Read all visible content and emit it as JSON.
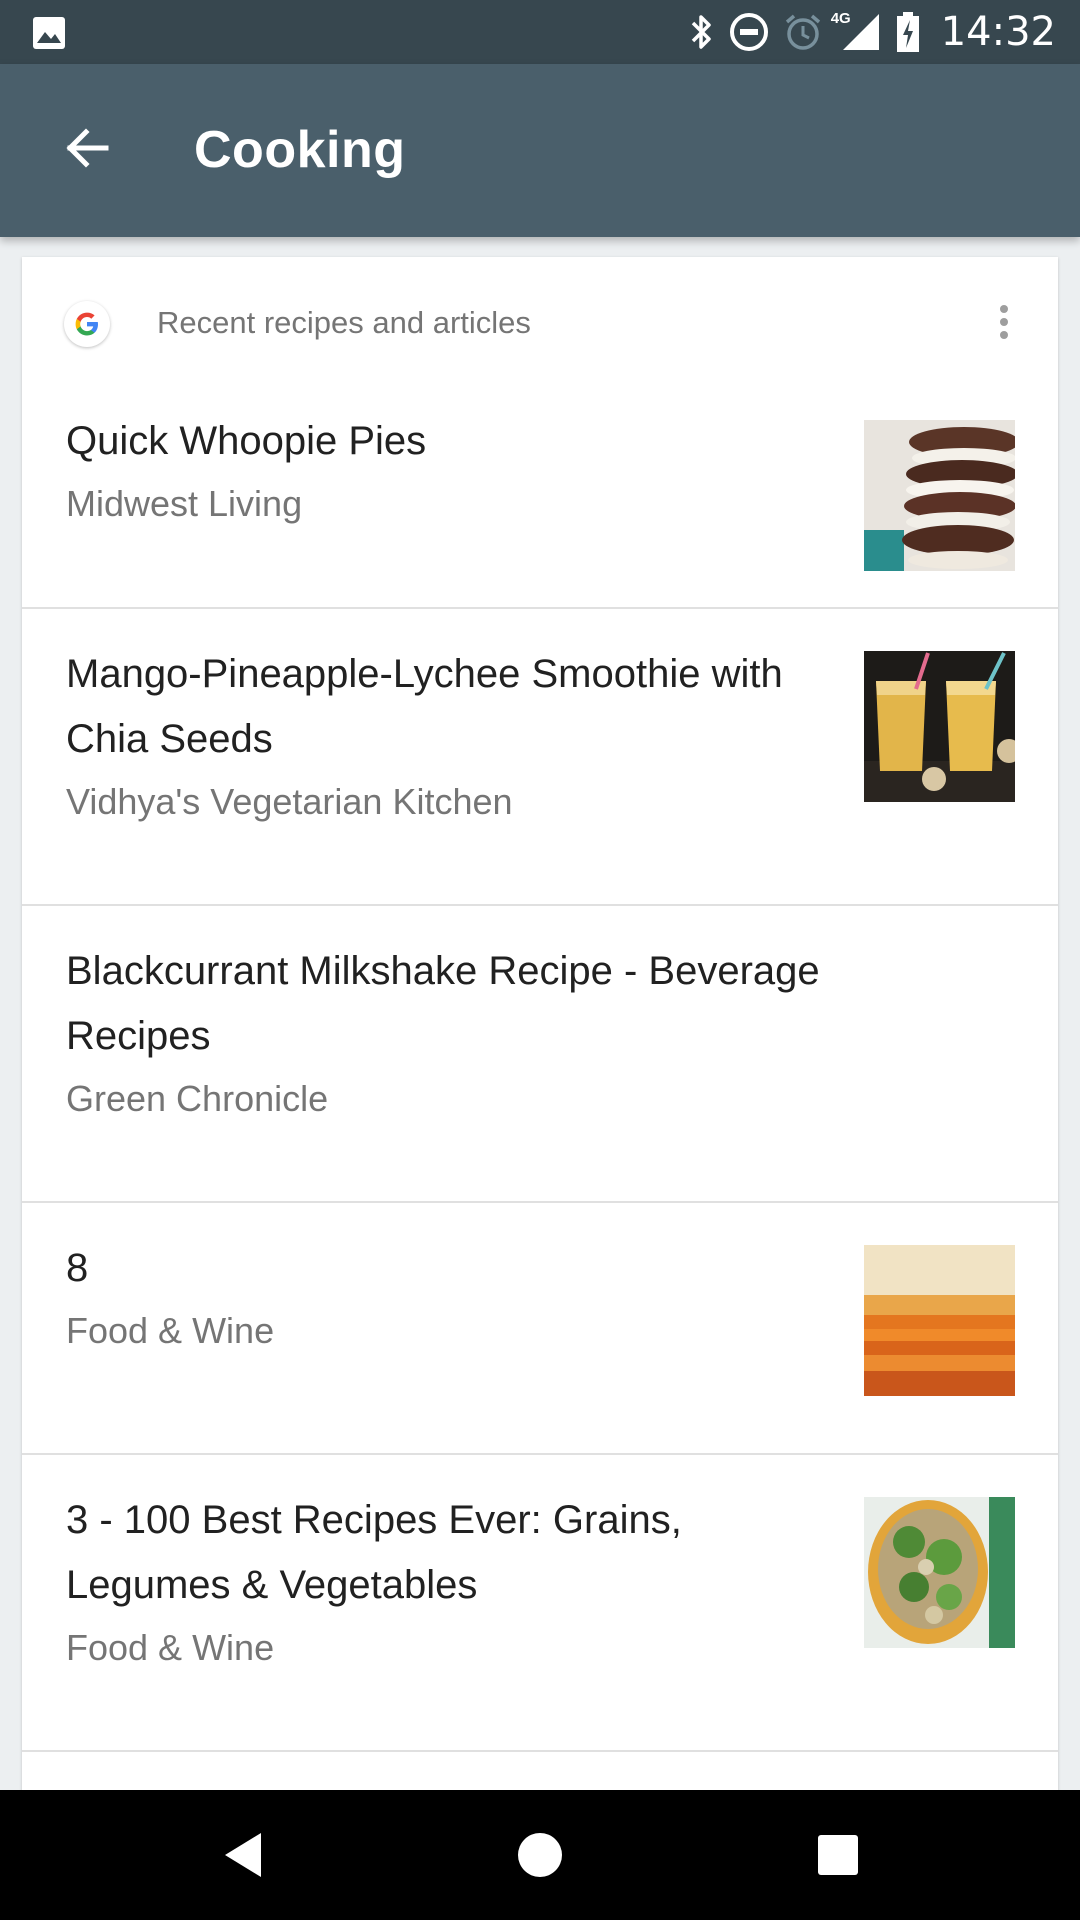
{
  "status_bar": {
    "time": "14:32",
    "network_label": "4G",
    "icons": [
      "image-icon",
      "bluetooth-icon",
      "do-not-disturb-icon",
      "alarm-icon",
      "signal-icon",
      "battery-charging-icon"
    ]
  },
  "app_bar": {
    "title": "Cooking",
    "back_icon": "arrow-back-icon"
  },
  "card": {
    "header_label": "Recent recipes and articles",
    "items": [
      {
        "title": "Quick Whoopie Pies",
        "source": "Midwest Living",
        "thumbnail": "whoopie-pies-photo"
      },
      {
        "title": "Mango-Pineapple-Lychee Smoothie with Chia Seeds",
        "source": "Vidhya's Vegetarian Kitchen",
        "thumbnail": "smoothie-photo"
      },
      {
        "title": "Blackcurrant Milkshake Recipe - Beverage Recipes",
        "source": "Green Chronicle"
      },
      {
        "title": "8",
        "source": "Food & Wine",
        "thumbnail": "sweet-potato-gratin-photo"
      },
      {
        "title": "3 - 100 Best Recipes Ever: Grains, Legumes & Vegetables",
        "source": "Food & Wine",
        "thumbnail": "stuffed-squash-photo"
      }
    ]
  },
  "colors": {
    "status_bar": "#37474f",
    "app_bar": "#4a5f6b",
    "background": "#eceff1",
    "title_text": "#212121",
    "secondary_text": "#757575"
  },
  "nav_bar": {
    "buttons": [
      "back-triangle-icon",
      "home-circle-icon",
      "recents-square-icon"
    ]
  }
}
